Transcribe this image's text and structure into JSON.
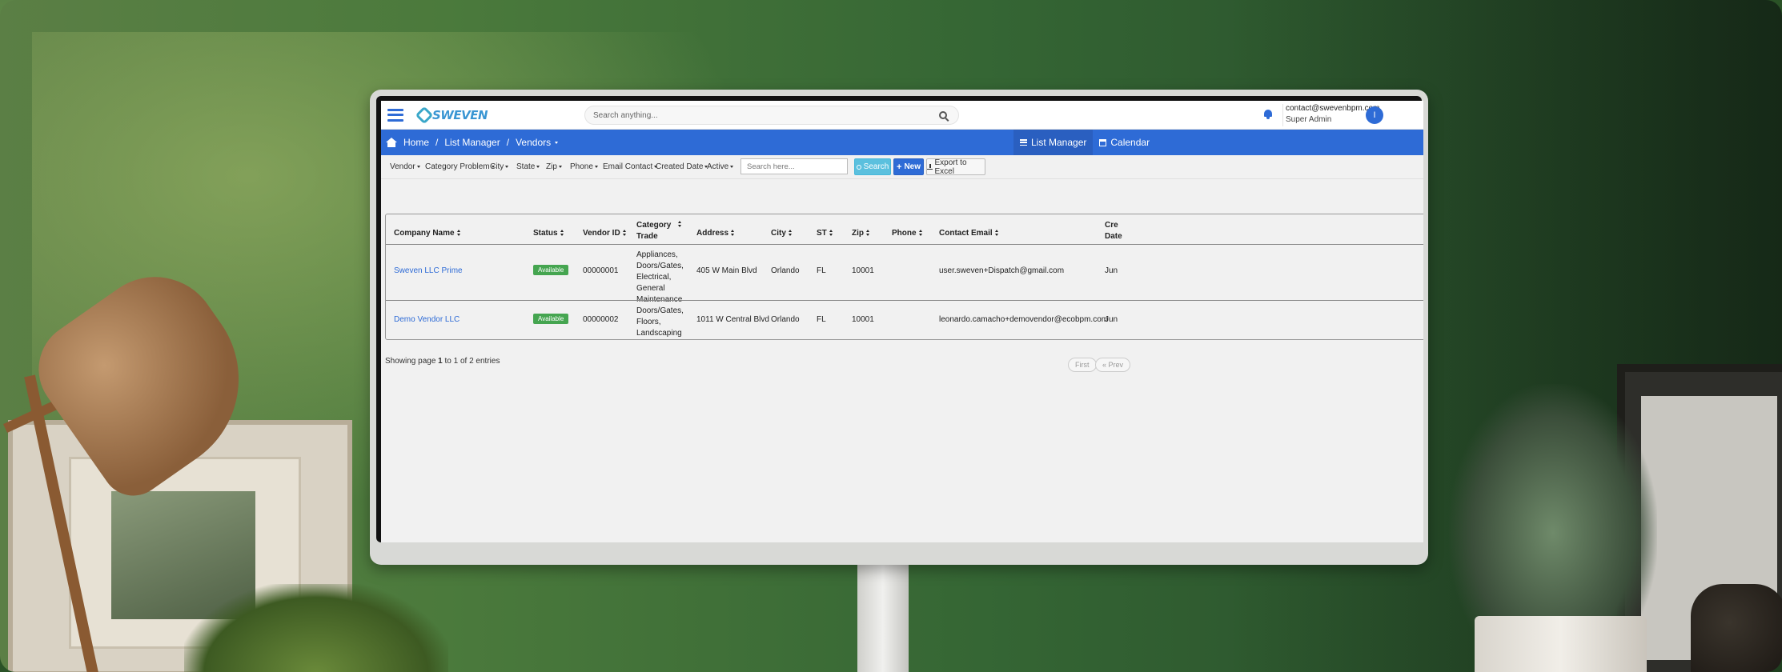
{
  "app": {
    "search": {
      "placeholder": "Search anything..."
    },
    "user": {
      "email": "contact@swevenbpm.com",
      "role": "Super Admin",
      "avatar_initial": "I"
    },
    "logo": {
      "name": "SWEVEN"
    }
  },
  "breadcrumb": [
    {
      "label": "Home"
    },
    {
      "label": "List Manager"
    },
    {
      "label": "Vendors"
    }
  ],
  "nav_tabs": [
    {
      "label": "List Manager"
    },
    {
      "label": "Calendar"
    }
  ],
  "filters": [
    "Vendor",
    "Category Problem",
    "City",
    "State",
    "Zip",
    "Phone",
    "Email Contact",
    "Created Date",
    "Active"
  ],
  "filter_search": {
    "placeholder": "Search here..."
  },
  "buttons": {
    "search": "Search",
    "new": "New",
    "export": "Export to Excel"
  },
  "table": {
    "headers": {
      "company": "Company Name",
      "status": "Status",
      "vendor_id": "Vendor ID",
      "category_1": "Category",
      "category_2": "Trade",
      "address": "Address",
      "city": "City",
      "st": "ST",
      "zip": "Zip",
      "phone": "Phone",
      "email": "Contact Email",
      "created_1": "Cre",
      "created_2": "Date"
    },
    "rows": [
      {
        "company": "Sweven LLC Prime",
        "status": "Available",
        "vendor_id": "00000001",
        "category": [
          "Appliances,",
          "Doors/Gates,",
          "Electrical,",
          "General",
          "Maintenance"
        ],
        "address": "405 W Main Blvd",
        "city": "Orlando",
        "st": "FL",
        "zip": "10001",
        "phone": "",
        "email": "user.sweven+Dispatch@gmail.com",
        "created": "Jun"
      },
      {
        "company": "Demo Vendor LLC",
        "status": "Available",
        "vendor_id": "00000002",
        "category": [
          "Doors/Gates,",
          "Floors,",
          "Landscaping"
        ],
        "address": "1011 W Central Blvd",
        "city": "Orlando",
        "st": "FL",
        "zip": "10001",
        "phone": "",
        "email": "leonardo.camacho+demovendor@ecobpm.com",
        "created": "Jun"
      }
    ]
  },
  "pagination": {
    "info_prefix": "Showing page",
    "page": "1",
    "info_suffix": "to 1 of 2 entries",
    "first": "First",
    "prev": "« Prev"
  },
  "colors": {
    "primary": "#2e6bd6",
    "info": "#5bc0de",
    "success": "#45a550"
  }
}
